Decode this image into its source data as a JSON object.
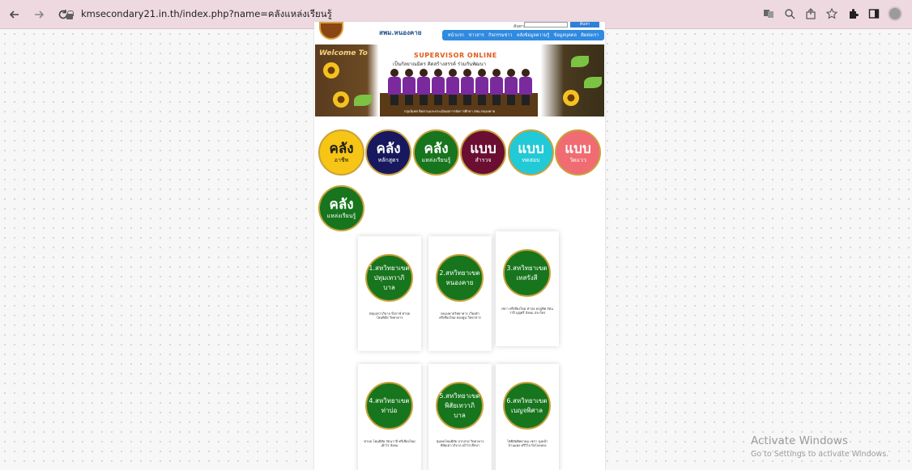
{
  "browser": {
    "url": "kmsecondary21.in.th/index.php?name=คลังแหล่งเรียนรู้",
    "back_icon": "arrow-left-icon",
    "forward_icon": "arrow-right-icon",
    "reload_icon": "reload-icon"
  },
  "site": {
    "name": "สพม.หนองคาย",
    "search_label": "ค้นหา",
    "search_button": "ค้นหา",
    "menu": [
      "หน้าแรก",
      "ข่าวสาร",
      "กิจกรรมข่าว",
      "คลังข้อมูลความรู้",
      "ข้อมูลบุคคล",
      "ติดต่อเรา"
    ]
  },
  "banner": {
    "welcome": "Welcome To",
    "title": "SUPERVISOR ONLINE",
    "tagline": "เป็นกัลยาณมิตร คิดสร้างสรรค์ ร่วมกันพัฒนา",
    "caption": "กลุ่มนิเทศ ติดตามและประเมินผลการจัดการศึกษา สพม.หนองคาย"
  },
  "categories": [
    {
      "big": "คลัง",
      "small": "อาชีพ",
      "bg": "#f6c515",
      "fg": "#1a1a1a"
    },
    {
      "big": "คลัง",
      "small": "หลักสูตร",
      "bg": "#18185e",
      "fg": "#ffffff"
    },
    {
      "big": "คลัง",
      "small": "แหล่งเรียนรู้",
      "bg": "#17751d",
      "fg": "#ffffff"
    },
    {
      "big": "แบบ",
      "small": "สำรวจ",
      "bg": "#6a0f32",
      "fg": "#ffffff"
    },
    {
      "big": "แบบ",
      "small": "ทดสอบ",
      "bg": "#22c9d6",
      "fg": "#ffffff"
    },
    {
      "big": "แบบ",
      "small": "วัดแวว",
      "bg": "#f06b72",
      "fg": "#ffffff"
    },
    {
      "big": "คลัง",
      "small": "แหล่งเรียนรู้",
      "bg": "#17751d",
      "fg": "#ffffff"
    }
  ],
  "schools": [
    {
      "title": "1.สหวิทยาเขต ปทุมเทวาภิบาล",
      "desc": "ปทุมเทวาภิบาล บึงกาฬ ท่าบ่อ โพนพิสัย วิทยาคาร"
    },
    {
      "title": "2.สหวิทยาเขต หนองคาย",
      "desc": "หนองคายวิทยาคาร เวียงคำ ศรีเชียงใหม่ ทองพูน วิทยาสาร"
    },
    {
      "title": "3.สหวิทยาเขต เทสรังสี",
      "desc": "เซกา ศรีเชียงใหม่ ท่าบ่อ ครุอุทิศ รัตนวาปี บุญศรี สังคม สระใคร"
    },
    {
      "title": "4.สหวิทยาเขต ท่าบ่อ",
      "desc": "ท่าบ่อ โพนพิสัย รัตนวาปี ศรีเชียงใหม่ เฝ้าไร่ สังคม"
    },
    {
      "title": "5.สหวิทยาเขต พิสัยเทวาภิบาล",
      "desc": "ชุมพลโพนพิสัย ปากสวย วิทยาคาร พิสัยเทวาภิบาล เฝ้าไร่ ศึกษา"
    },
    {
      "title": "6.สหวิทยาเขต เบญจพิศาล",
      "desc": "โซ่พิสัยพิทยาคม เซกา บุ่งคล้า บ้านแพง ศรีวิไล บึงโขงหลง"
    }
  ],
  "windows_notice": {
    "line1": "Activate Windows",
    "line2": "Go to Settings to activate Windows."
  }
}
